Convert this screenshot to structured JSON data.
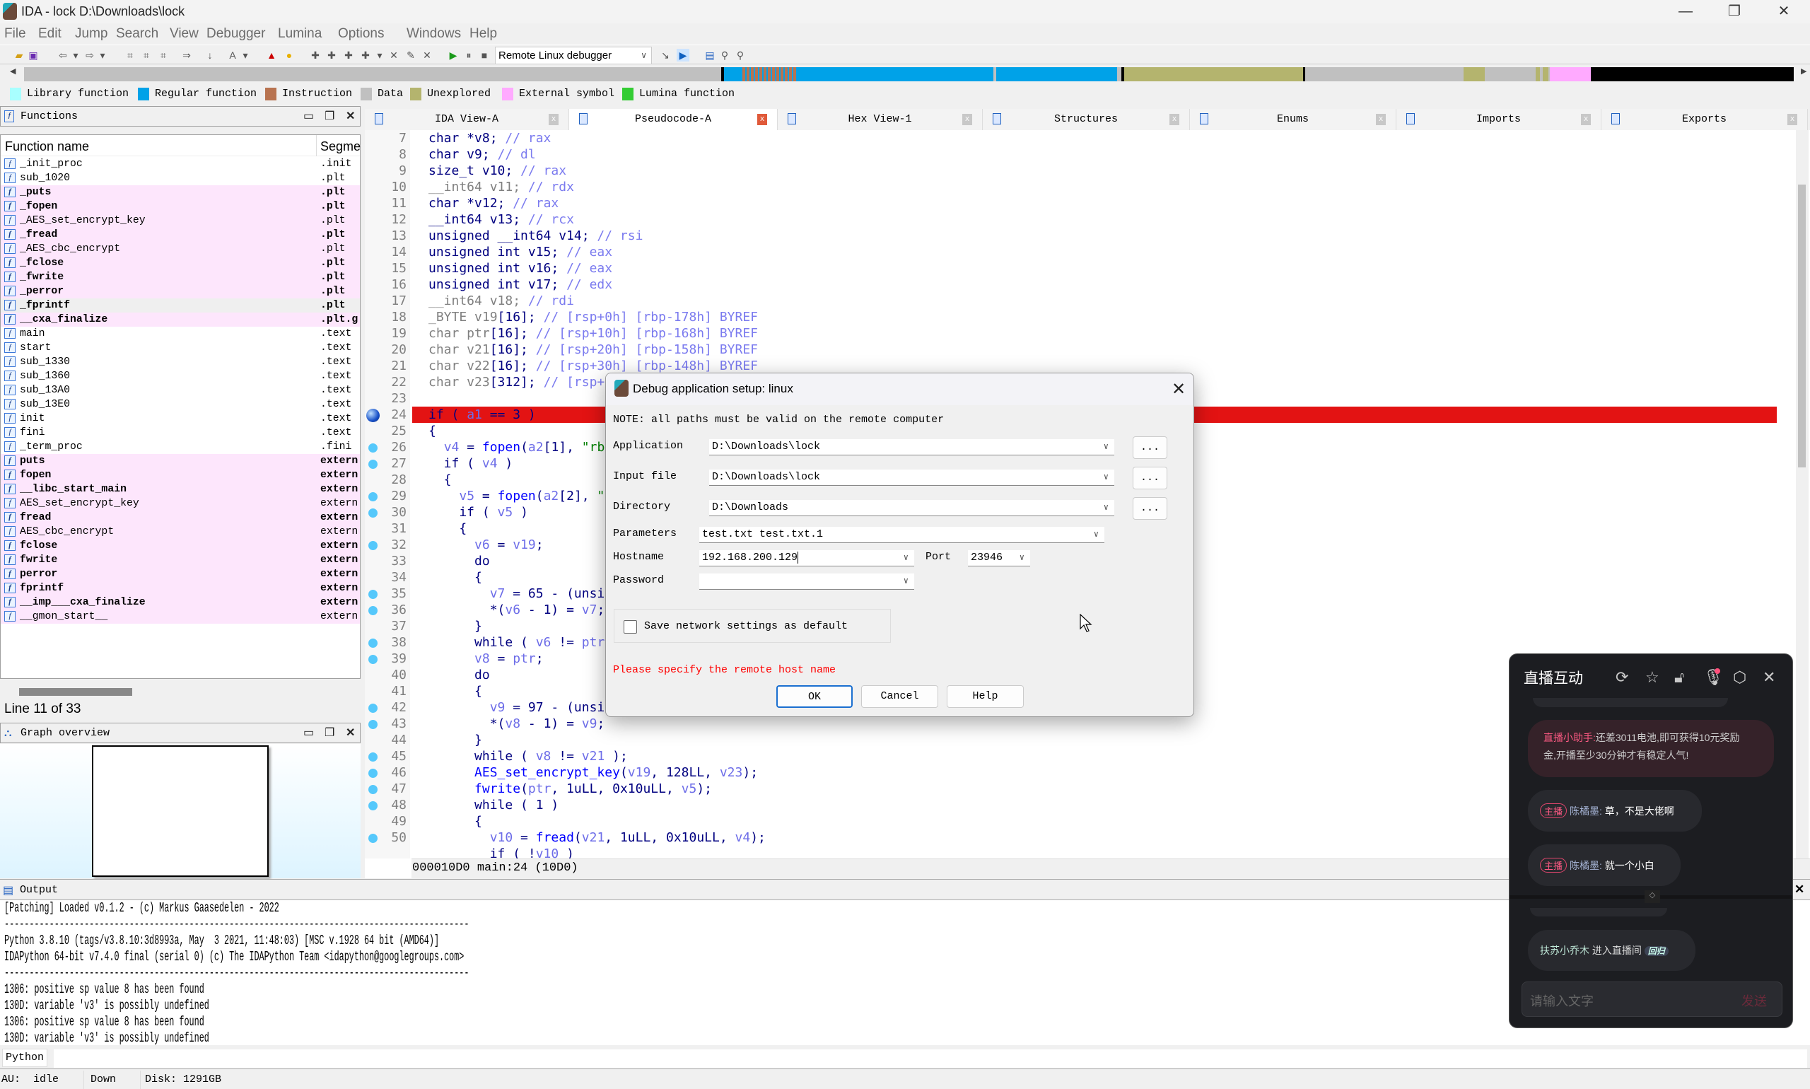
{
  "window": {
    "title": "IDA - lock D:\\Downloads\\lock",
    "minimize": "—",
    "maximize": "❐",
    "close": "✕"
  },
  "menu": [
    "File",
    "Edit",
    "Jump",
    "Search",
    "View",
    "Debugger",
    "Lumina",
    "Options",
    "Windows",
    "Help"
  ],
  "toolbar": {
    "debugger_select": "Remote Linux debugger"
  },
  "legend": [
    {
      "label": "Library function",
      "color": "#a8ffff"
    },
    {
      "label": "Regular function",
      "color": "#00a2e8"
    },
    {
      "label": "Instruction",
      "color": "#b87350"
    },
    {
      "label": "Data",
      "color": "#c0c0c0"
    },
    {
      "label": "Unexplored",
      "color": "#b4b46e"
    },
    {
      "label": "External symbol",
      "color": "#ffaaff"
    },
    {
      "label": "Lumina function",
      "color": "#33cc33"
    }
  ],
  "functions": {
    "title": "Functions",
    "col_name": "Function name",
    "col_segment": "Segme",
    "rows": [
      {
        "name": "_init_proc",
        "seg": ".init",
        "style": ""
      },
      {
        "name": "sub_1020",
        "seg": ".plt",
        "style": ""
      },
      {
        "name": "_puts",
        "seg": ".plt",
        "style": "pink b"
      },
      {
        "name": "_fopen",
        "seg": ".plt",
        "style": "pink b"
      },
      {
        "name": "_AES_set_encrypt_key",
        "seg": ".plt",
        "style": "pink"
      },
      {
        "name": "_fread",
        "seg": ".plt",
        "style": "pink b"
      },
      {
        "name": "_AES_cbc_encrypt",
        "seg": ".plt",
        "style": "pink"
      },
      {
        "name": "_fclose",
        "seg": ".plt",
        "style": "pink b"
      },
      {
        "name": "_fwrite",
        "seg": ".plt",
        "style": "pink b"
      },
      {
        "name": "_perror",
        "seg": ".plt",
        "style": "pink b"
      },
      {
        "name": "_fprintf",
        "seg": ".plt",
        "style": "sel b"
      },
      {
        "name": "__cxa_finalize",
        "seg": ".plt.g",
        "style": "pink b"
      },
      {
        "name": "main",
        "seg": ".text",
        "style": ""
      },
      {
        "name": "start",
        "seg": ".text",
        "style": ""
      },
      {
        "name": "sub_1330",
        "seg": ".text",
        "style": ""
      },
      {
        "name": "sub_1360",
        "seg": ".text",
        "style": ""
      },
      {
        "name": "sub_13A0",
        "seg": ".text",
        "style": ""
      },
      {
        "name": "sub_13E0",
        "seg": ".text",
        "style": ""
      },
      {
        "name": "init",
        "seg": ".text",
        "style": ""
      },
      {
        "name": "fini",
        "seg": ".text",
        "style": ""
      },
      {
        "name": "_term_proc",
        "seg": ".fini",
        "style": ""
      },
      {
        "name": "puts",
        "seg": "extern",
        "style": "pink b"
      },
      {
        "name": "fopen",
        "seg": "extern",
        "style": "pink b"
      },
      {
        "name": "__libc_start_main",
        "seg": "extern",
        "style": "pink b"
      },
      {
        "name": "AES_set_encrypt_key",
        "seg": "extern",
        "style": "pink"
      },
      {
        "name": "fread",
        "seg": "extern",
        "style": "pink b"
      },
      {
        "name": "AES_cbc_encrypt",
        "seg": "extern",
        "style": "pink"
      },
      {
        "name": "fclose",
        "seg": "extern",
        "style": "pink b"
      },
      {
        "name": "fwrite",
        "seg": "extern",
        "style": "pink b"
      },
      {
        "name": "perror",
        "seg": "extern",
        "style": "pink b"
      },
      {
        "name": "fprintf",
        "seg": "extern",
        "style": "pink b"
      },
      {
        "name": "__imp___cxa_finalize",
        "seg": "extern",
        "style": "pink b"
      },
      {
        "name": "__gmon_start__",
        "seg": "extern",
        "style": "pink"
      }
    ],
    "status": "Line 11 of 33"
  },
  "graph_overview": {
    "title": "Graph overview"
  },
  "tabs": [
    {
      "label": "IDA View-A",
      "active": false
    },
    {
      "label": "Pseudocode-A",
      "active": true
    },
    {
      "label": "Hex View-1",
      "active": false
    },
    {
      "label": "Structures",
      "active": false
    },
    {
      "label": "Enums",
      "active": false
    },
    {
      "label": "Imports",
      "active": false
    },
    {
      "label": "Exports",
      "active": false
    }
  ],
  "code": {
    "lines": [
      {
        "n": "7",
        "bp": "",
        "t": [
          [
            "k",
            "char *v8; "
          ],
          [
            "c",
            "// rax"
          ]
        ]
      },
      {
        "n": "8",
        "bp": "",
        "t": [
          [
            "k",
            "char v9; "
          ],
          [
            "c",
            "// dl"
          ]
        ]
      },
      {
        "n": "9",
        "bp": "",
        "t": [
          [
            "k",
            "size_t v10; "
          ],
          [
            "c",
            "// rax"
          ]
        ]
      },
      {
        "n": "10",
        "bp": "",
        "t": [
          [
            "g",
            "__int64 v11; "
          ],
          [
            "c",
            "// rdx"
          ]
        ]
      },
      {
        "n": "11",
        "bp": "",
        "t": [
          [
            "k",
            "char *v12; "
          ],
          [
            "c",
            "// rax"
          ]
        ]
      },
      {
        "n": "12",
        "bp": "",
        "t": [
          [
            "k",
            "__int64 v13; "
          ],
          [
            "c",
            "// rcx"
          ]
        ]
      },
      {
        "n": "13",
        "bp": "",
        "t": [
          [
            "k",
            "unsigned __int64 v14; "
          ],
          [
            "c",
            "// rsi"
          ]
        ]
      },
      {
        "n": "14",
        "bp": "",
        "t": [
          [
            "k",
            "unsigned int v15; "
          ],
          [
            "c",
            "// eax"
          ]
        ]
      },
      {
        "n": "15",
        "bp": "",
        "t": [
          [
            "k",
            "unsigned int v16; "
          ],
          [
            "c",
            "// eax"
          ]
        ]
      },
      {
        "n": "16",
        "bp": "",
        "t": [
          [
            "k",
            "unsigned int v17; "
          ],
          [
            "c",
            "// edx"
          ]
        ]
      },
      {
        "n": "17",
        "bp": "",
        "t": [
          [
            "g",
            "__int64 v18; "
          ],
          [
            "c",
            "// rdi"
          ]
        ]
      },
      {
        "n": "18",
        "bp": "",
        "t": [
          [
            "g",
            "_BYTE v19"
          ],
          [
            "k",
            "[16]; "
          ],
          [
            "c",
            "// [rsp+0h] [rbp-178h] BYREF"
          ]
        ]
      },
      {
        "n": "19",
        "bp": "",
        "t": [
          [
            "g",
            "char ptr"
          ],
          [
            "k",
            "[16]; "
          ],
          [
            "c",
            "// [rsp+10h] [rbp-168h] BYREF"
          ]
        ]
      },
      {
        "n": "20",
        "bp": "",
        "t": [
          [
            "g",
            "char v21"
          ],
          [
            "k",
            "[16]; "
          ],
          [
            "c",
            "// [rsp+20h] [rbp-158h] BYREF"
          ]
        ]
      },
      {
        "n": "21",
        "bp": "",
        "t": [
          [
            "g",
            "char v22"
          ],
          [
            "k",
            "[16]; "
          ],
          [
            "c",
            "// [rsp+30h] [rbp-148h] BYREF"
          ]
        ]
      },
      {
        "n": "22",
        "bp": "",
        "t": [
          [
            "g",
            "char v23"
          ],
          [
            "k",
            "[312]; "
          ],
          [
            "c",
            "// [rsp+"
          ]
        ]
      },
      {
        "n": "23",
        "bp": "",
        "t": []
      },
      {
        "n": "24",
        "bp": "current",
        "t": [
          [
            "k",
            "if ( "
          ],
          [
            "v",
            "a1"
          ],
          [
            "k",
            " == 3 )"
          ]
        ]
      },
      {
        "n": "25",
        "bp": "",
        "t": [
          [
            "k",
            "{"
          ]
        ]
      },
      {
        "n": "26",
        "bp": "dot",
        "t": [
          [
            "k",
            "  "
          ],
          [
            "v",
            "v4"
          ],
          [
            "k",
            " = "
          ],
          [
            "f",
            "fopen"
          ],
          [
            "k",
            "("
          ],
          [
            "v",
            "a2"
          ],
          [
            "k",
            "[1], "
          ],
          [
            "s",
            "\"rb"
          ]
        ]
      },
      {
        "n": "27",
        "bp": "dot",
        "t": [
          [
            "k",
            "  if ( "
          ],
          [
            "v",
            "v4"
          ],
          [
            "k",
            " )"
          ]
        ]
      },
      {
        "n": "28",
        "bp": "",
        "t": [
          [
            "k",
            "  {"
          ]
        ]
      },
      {
        "n": "29",
        "bp": "dot",
        "t": [
          [
            "k",
            "    "
          ],
          [
            "v",
            "v5"
          ],
          [
            "k",
            " = "
          ],
          [
            "f",
            "fopen"
          ],
          [
            "k",
            "("
          ],
          [
            "v",
            "a2"
          ],
          [
            "k",
            "[2], "
          ],
          [
            "s",
            "\""
          ]
        ]
      },
      {
        "n": "30",
        "bp": "dot",
        "t": [
          [
            "k",
            "    if ( "
          ],
          [
            "v",
            "v5"
          ],
          [
            "k",
            " )"
          ]
        ]
      },
      {
        "n": "31",
        "bp": "",
        "t": [
          [
            "k",
            "    {"
          ]
        ]
      },
      {
        "n": "32",
        "bp": "dot",
        "t": [
          [
            "k",
            "      "
          ],
          [
            "v",
            "v6"
          ],
          [
            "k",
            " = "
          ],
          [
            "v",
            "v19"
          ],
          [
            "k",
            ";"
          ]
        ]
      },
      {
        "n": "33",
        "bp": "",
        "t": [
          [
            "k",
            "      do"
          ]
        ]
      },
      {
        "n": "34",
        "bp": "",
        "t": [
          [
            "k",
            "      {"
          ]
        ]
      },
      {
        "n": "35",
        "bp": "dot",
        "t": [
          [
            "k",
            "        "
          ],
          [
            "v",
            "v7"
          ],
          [
            "k",
            " = 65 - (unsi"
          ]
        ]
      },
      {
        "n": "36",
        "bp": "dot",
        "t": [
          [
            "k",
            "        *("
          ],
          [
            "v",
            "v6"
          ],
          [
            "k",
            " - 1) = "
          ],
          [
            "v",
            "v7"
          ],
          [
            "k",
            ";"
          ]
        ]
      },
      {
        "n": "37",
        "bp": "",
        "t": [
          [
            "k",
            "      }"
          ]
        ]
      },
      {
        "n": "38",
        "bp": "dot",
        "t": [
          [
            "k",
            "      while ( "
          ],
          [
            "v",
            "v6"
          ],
          [
            "k",
            " != "
          ],
          [
            "v",
            "ptr"
          ]
        ]
      },
      {
        "n": "39",
        "bp": "dot",
        "t": [
          [
            "k",
            "      "
          ],
          [
            "v",
            "v8"
          ],
          [
            "k",
            " = "
          ],
          [
            "v",
            "ptr"
          ],
          [
            "k",
            ";"
          ]
        ]
      },
      {
        "n": "40",
        "bp": "",
        "t": [
          [
            "k",
            "      do"
          ]
        ]
      },
      {
        "n": "41",
        "bp": "",
        "t": [
          [
            "k",
            "      {"
          ]
        ]
      },
      {
        "n": "42",
        "bp": "dot",
        "t": [
          [
            "k",
            "        "
          ],
          [
            "v",
            "v9"
          ],
          [
            "k",
            " = 97 - (unsi"
          ]
        ]
      },
      {
        "n": "43",
        "bp": "dot",
        "t": [
          [
            "k",
            "        *("
          ],
          [
            "v",
            "v8"
          ],
          [
            "k",
            " - 1) = "
          ],
          [
            "v",
            "v9"
          ],
          [
            "k",
            ";"
          ]
        ]
      },
      {
        "n": "44",
        "bp": "",
        "t": [
          [
            "k",
            "      }"
          ]
        ]
      },
      {
        "n": "45",
        "bp": "dot",
        "t": [
          [
            "k",
            "      while ( "
          ],
          [
            "v",
            "v8"
          ],
          [
            "k",
            " != "
          ],
          [
            "v",
            "v21"
          ],
          [
            "k",
            " );"
          ]
        ]
      },
      {
        "n": "46",
        "bp": "dot",
        "t": [
          [
            "k",
            "      "
          ],
          [
            "f",
            "AES_set_encrypt_key"
          ],
          [
            "k",
            "("
          ],
          [
            "v",
            "v19"
          ],
          [
            "k",
            ", 128LL, "
          ],
          [
            "v",
            "v23"
          ],
          [
            "k",
            ");"
          ]
        ]
      },
      {
        "n": "47",
        "bp": "dot",
        "t": [
          [
            "k",
            "      "
          ],
          [
            "f",
            "fwrite"
          ],
          [
            "k",
            "("
          ],
          [
            "v",
            "ptr"
          ],
          [
            "k",
            ", 1uLL, 0x10uLL, "
          ],
          [
            "v",
            "v5"
          ],
          [
            "k",
            ");"
          ]
        ]
      },
      {
        "n": "48",
        "bp": "dot",
        "t": [
          [
            "k",
            "      while ( 1 )"
          ]
        ]
      },
      {
        "n": "49",
        "bp": "",
        "t": [
          [
            "k",
            "      {"
          ]
        ]
      },
      {
        "n": "50",
        "bp": "dot",
        "t": [
          [
            "k",
            "        "
          ],
          [
            "v",
            "v10"
          ],
          [
            "k",
            " = "
          ],
          [
            "f",
            "fread"
          ],
          [
            "k",
            "("
          ],
          [
            "v",
            "v21"
          ],
          [
            "k",
            ", 1uLL, 0x10uLL, "
          ],
          [
            "v",
            "v4"
          ],
          [
            "k",
            ");"
          ]
        ]
      },
      {
        "n": "",
        "bp": "",
        "t": [
          [
            "k",
            "        if ( !"
          ],
          [
            "v",
            "v10"
          ],
          [
            "k",
            " )"
          ]
        ]
      }
    ],
    "status": "000010D0 main:24 (10D0)"
  },
  "output": {
    "title": "Output",
    "lines": [
      "[Patching] Loaded v0.1.2 - (c) Markus Gaasedelen - 2022",
      "---------------------------------------------------------------------------------------------",
      "Python 3.8.10 (tags/v3.8.10:3d8993a, May  3 2021, 11:48:03) [MSC v.1928 64 bit (AMD64)]",
      "IDAPython 64-bit v7.4.0 final (serial 0) (c) The IDAPython Team <idapython@googlegroups.com>",
      "---------------------------------------------------------------------------------------------",
      "1306: positive sp value 8 has been found",
      "130D: variable 'v3' is possibly undefined",
      "1306: positive sp value 8 has been found",
      "130D: variable 'v3' is possibly undefined"
    ],
    "lang_button": "Python"
  },
  "statusbar": {
    "au": "AU:  idle",
    "state": "Down",
    "disk": "Disk: 1291GB"
  },
  "dialog": {
    "title": "Debug application setup: linux",
    "note": "NOTE: all paths must be valid on the remote computer",
    "application_label": "Application",
    "application": "D:\\Downloads\\lock",
    "input_label": "Input file",
    "input": "D:\\Downloads\\lock",
    "directory_label": "Directory",
    "directory": "D:\\Downloads",
    "parameters_label": "Parameters",
    "parameters": "test.txt test.txt.1",
    "hostname_label": "Hostname",
    "hostname": "192.168.200.129",
    "port_label": "Port",
    "port": "23946",
    "password_label": "Password",
    "password": "",
    "browse": "...",
    "save_default_label": "Save network settings as default",
    "save_default_checked": false,
    "error": "Please specify the remote host name",
    "ok": "OK",
    "cancel": "Cancel",
    "help": "Help"
  },
  "chat": {
    "title": "直播互动",
    "icons": [
      "refresh-icon",
      "effects-off-icon",
      "unlock-icon",
      "mic-icon",
      "settings-icon",
      "close-icon"
    ],
    "assistant_name": "直播小助手:",
    "assistant_msg_1": "还差3011电池,即可获得10元奖励",
    "assistant_msg_2": "金,开播至少30分钟才有稳定人气!",
    "messages": [
      {
        "tag": "主播",
        "user": "陈橘墨:",
        "text": "草，不是大佬啊"
      },
      {
        "tag": "主播",
        "user": "陈橘墨:",
        "text": "就一个小白"
      }
    ],
    "enter_user": "扶苏小乔木",
    "enter_text": "进入直播间",
    "enter_badge": "回归",
    "input_placeholder": "请输入文字",
    "send": "发送"
  }
}
